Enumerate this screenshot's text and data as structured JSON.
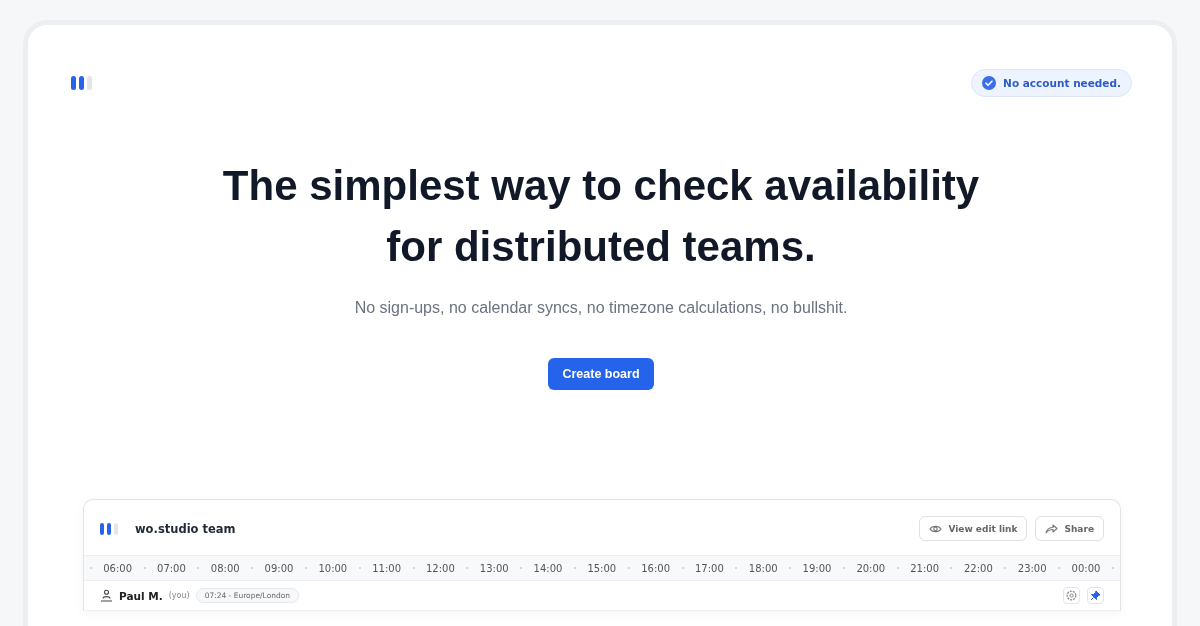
{
  "header": {
    "badge": "No account needed."
  },
  "hero": {
    "title": "The simplest way to check availability for distributed teams.",
    "subtitle": "No sign-ups, no calendar syncs, no timezone calculations, no bullshit.",
    "cta": "Create board"
  },
  "board": {
    "name": "wo.studio team",
    "actions": [
      "View edit link",
      "Share"
    ],
    "hours": [
      "06:00",
      "07:00",
      "08:00",
      "09:00",
      "10:00",
      "11:00",
      "12:00",
      "13:00",
      "14:00",
      "15:00",
      "16:00",
      "17:00",
      "18:00",
      "19:00",
      "20:00",
      "21:00",
      "22:00",
      "23:00",
      "00:00"
    ],
    "members": [
      {
        "name": "Paul M.",
        "note": "(you)",
        "timezone": "07:24 - Europe/London",
        "pinned": true
      }
    ]
  }
}
